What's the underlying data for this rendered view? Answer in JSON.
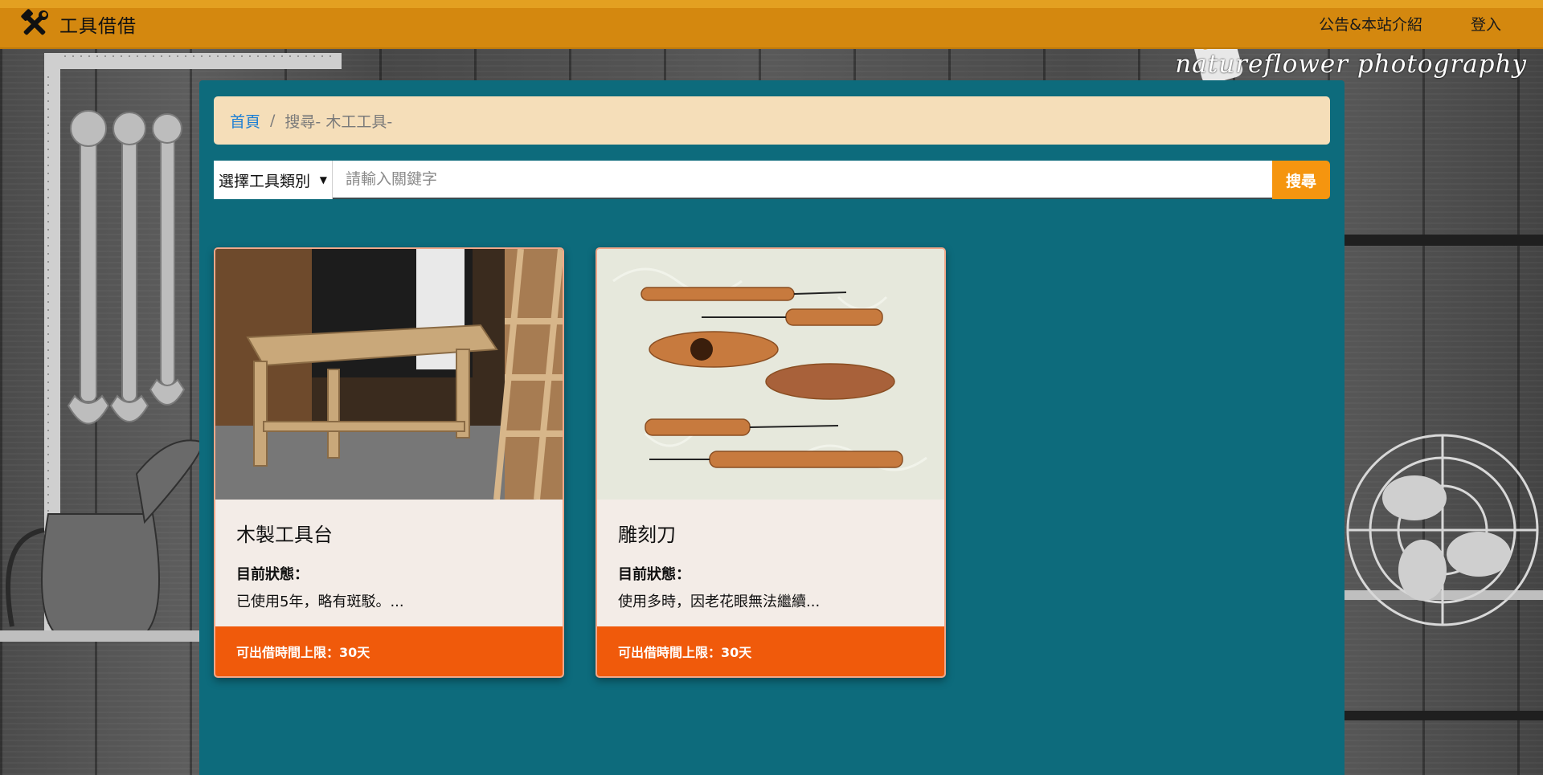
{
  "navbar": {
    "brand_icon": "hammer-wrench-icon",
    "brand_text": "工具借借",
    "links": [
      "公告&本站介紹",
      "登入"
    ]
  },
  "watermark": "natureflower photography",
  "breadcrumb": {
    "home": "首頁",
    "separator": "/",
    "current": "搜尋- 木工工具-"
  },
  "search": {
    "category_label": "選擇工具類別",
    "placeholder": "請輸入關鍵字",
    "button_label": "搜尋"
  },
  "cards": [
    {
      "title": "木製工具台",
      "status_label": "目前狀態：",
      "description": "已使用5年，略有斑駁。...",
      "footer": "可出借時間上限：30天",
      "image_icon": "wooden-workbench-photo"
    },
    {
      "title": "雕刻刀",
      "status_label": "目前狀態：",
      "description": "使用多時，因老花眼無法繼續...",
      "footer": "可出借時間上限：30天",
      "image_icon": "carving-tools-photo"
    }
  ],
  "colors": {
    "navbar": "#d4880f",
    "panel": "#0d6b7c",
    "breadcrumb_bg": "#f5deb9",
    "search_button": "#f5950f",
    "card_footer": "#f05a0b"
  }
}
